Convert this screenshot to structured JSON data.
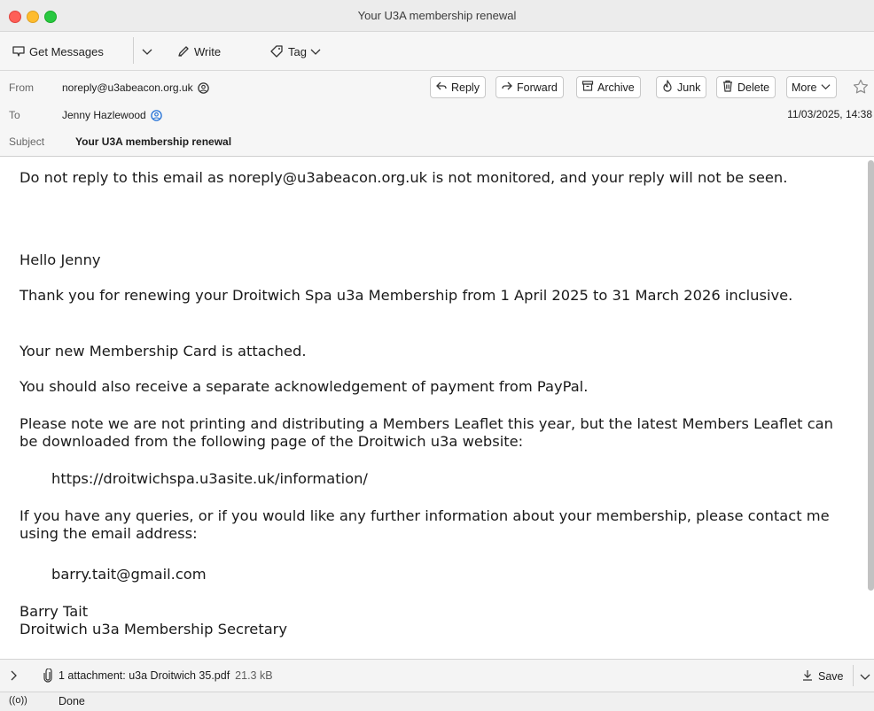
{
  "window": {
    "title": "Your U3A membership renewal"
  },
  "toolbar": {
    "get_messages": "Get Messages",
    "write": "Write",
    "tag": "Tag"
  },
  "header": {
    "from_label": "From",
    "from_value": "noreply@u3abeacon.org.uk",
    "to_label": "To",
    "to_value": "Jenny Hazlewood",
    "subject_label": "Subject",
    "subject_value": "Your U3A membership renewal",
    "datetime": "11/03/2025, 14:38",
    "actions": {
      "reply": "Reply",
      "forward": "Forward",
      "archive": "Archive",
      "junk": "Junk",
      "delete": "Delete",
      "more": "More"
    }
  },
  "body": {
    "p1": "Do not reply to this email as noreply@u3abeacon.org.uk is not monitored, and your reply will not be seen.",
    "p2": "Hello Jenny",
    "p3": "Thank you for renewing your Droitwich Spa u3a Membership from 1 April 2025 to 31 March 2026 inclusive.",
    "p4": "Your new Membership Card is attached.",
    "p5": "You should also receive a separate acknowledgement of payment from PayPal.",
    "p6": "Please note we are not printing and distributing a Members Leaflet this year, but the latest Members Leaflet can be downloaded from the following page of the Droitwich u3a website:",
    "link": "https://droitwichspa.u3asite.uk/information/",
    "p7": "If you have any queries, or if you would like any further information about your membership, please contact me using the email address:",
    "email": "barry.tait@gmail.com",
    "sig_name": "Barry Tait",
    "sig_title": "Droitwich u3a Membership Secretary"
  },
  "attachments": {
    "summary": "1 attachment: u3a Droitwich 35.pdf",
    "size": "21.3 kB",
    "save": "Save"
  },
  "status": {
    "text": "Done",
    "icon_glyph": "((o))"
  }
}
